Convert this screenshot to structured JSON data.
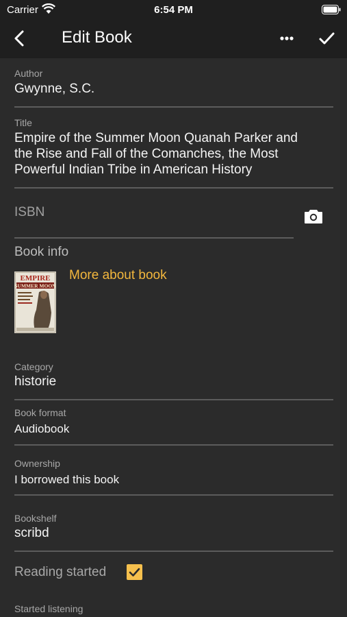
{
  "status_bar": {
    "carrier": "Carrier",
    "time": "6:54 PM"
  },
  "app_bar": {
    "title": "Edit Book"
  },
  "form": {
    "author": {
      "label": "Author",
      "value": "Gwynne, S.C."
    },
    "title": {
      "label": "Title",
      "lines": [
        "Empire of the Summer Moon Quanah Parker and",
        "the Rise and Fall of the Comanches, the Most",
        "Powerful Indian Tribe in American History"
      ]
    },
    "isbn": {
      "placeholder": "ISBN"
    },
    "book_info": {
      "heading": "Book info",
      "more_link": "More about book",
      "cover_text": {
        "line1": "EMPIRE",
        "line2": "SUMMER MOON"
      }
    },
    "category": {
      "label": "Category",
      "value": "historie"
    },
    "format": {
      "label": "Book format",
      "value": "Audiobook"
    },
    "ownership": {
      "label": "Ownership",
      "value": "I borrowed this book"
    },
    "bookshelf": {
      "label": "Bookshelf",
      "value": "scribd"
    },
    "reading_started": {
      "label": "Reading started",
      "checked": true
    },
    "started_listening": {
      "label": "Started listening"
    }
  },
  "colors": {
    "accent": "#f3b73d",
    "checkbox": "#f6c04d",
    "background": "#2b2b2b",
    "appbar": "#1f1f1f"
  }
}
